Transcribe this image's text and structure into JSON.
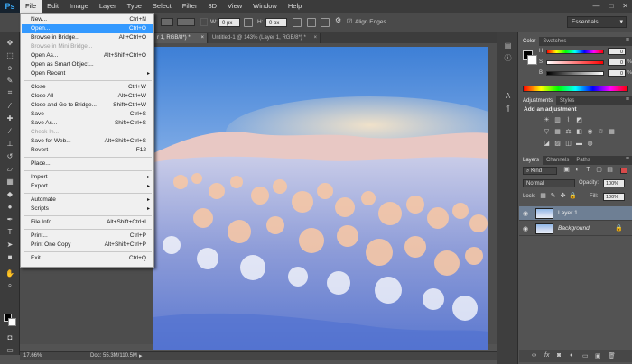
{
  "app": {
    "logo": "Ps"
  },
  "menubar": {
    "items": [
      "File",
      "Edit",
      "Image",
      "Layer",
      "Type",
      "Select",
      "Filter",
      "3D",
      "View",
      "Window",
      "Help"
    ],
    "active_index": 0
  },
  "window_controls": {
    "minimize": "—",
    "maximize": "□",
    "close": "✕"
  },
  "options_bar": {
    "w_label": "W:",
    "w_value": "0 px",
    "h_label": "H:",
    "h_value": "0 px",
    "align_edges": "Align Edges",
    "workspace": "Essentials"
  },
  "doc_tabs": [
    {
      "title": "r 1, RGB/8*) *",
      "close": "×"
    },
    {
      "title": "Untitled-1 @ 143% (Layer 1, RGB/8*) *",
      "close": "×"
    }
  ],
  "file_menu": {
    "items": [
      {
        "label": "New...",
        "shortcut": "Ctrl+N"
      },
      {
        "label": "Open...",
        "shortcut": "Ctrl+O",
        "highlight": true
      },
      {
        "label": "Browse in Bridge...",
        "shortcut": "Alt+Ctrl+O"
      },
      {
        "label": "Browse in Mini Bridge...",
        "shortcut": "",
        "disabled": true
      },
      {
        "label": "Open As...",
        "shortcut": "Alt+Shift+Ctrl+O"
      },
      {
        "label": "Open as Smart Object...",
        "shortcut": ""
      },
      {
        "label": "Open Recent",
        "shortcut": "",
        "submenu": true
      },
      {
        "label": "Close",
        "shortcut": "Ctrl+W"
      },
      {
        "label": "Close All",
        "shortcut": "Alt+Ctrl+W"
      },
      {
        "label": "Close and Go to Bridge...",
        "shortcut": "Shift+Ctrl+W"
      },
      {
        "label": "Save",
        "shortcut": "Ctrl+S"
      },
      {
        "label": "Save As...",
        "shortcut": "Shift+Ctrl+S"
      },
      {
        "label": "Check In...",
        "shortcut": "",
        "disabled": true
      },
      {
        "label": "Save for Web...",
        "shortcut": "Alt+Shift+Ctrl+S"
      },
      {
        "label": "Revert",
        "shortcut": "F12"
      },
      {
        "label": "Place...",
        "shortcut": ""
      },
      {
        "label": "Import",
        "shortcut": "",
        "submenu": true
      },
      {
        "label": "Export",
        "shortcut": "",
        "submenu": true
      },
      {
        "label": "Automate",
        "shortcut": "",
        "submenu": true
      },
      {
        "label": "Scripts",
        "shortcut": "",
        "submenu": true
      },
      {
        "label": "File Info...",
        "shortcut": "Alt+Shift+Ctrl+I"
      },
      {
        "label": "Print...",
        "shortcut": "Ctrl+P"
      },
      {
        "label": "Print One Copy",
        "shortcut": "Alt+Shift+Ctrl+P"
      },
      {
        "label": "Exit",
        "shortcut": "Ctrl+Q"
      }
    ],
    "submenu_arrow": "▸"
  },
  "color_panel": {
    "tabs": [
      "Color",
      "Swatches"
    ],
    "channels": [
      {
        "label": "H",
        "value": "0"
      },
      {
        "label": "S",
        "value": "0"
      },
      {
        "label": "B",
        "value": "0"
      }
    ],
    "percent": "%"
  },
  "adjustments_panel": {
    "tabs": [
      "Adjustments",
      "Styles"
    ],
    "title": "Add an adjustment"
  },
  "layers_panel": {
    "tabs": [
      "Layers",
      "Channels",
      "Paths"
    ],
    "kind": "Kind",
    "blend_mode": "Normal",
    "opacity_label": "Opacity:",
    "opacity_value": "100%",
    "lock_label": "Lock:",
    "fill_label": "Fill:",
    "fill_value": "100%",
    "layers": [
      {
        "name": "Layer 1",
        "selected": true
      },
      {
        "name": "Background",
        "italic": true,
        "locked": true
      }
    ]
  },
  "status_bar": {
    "zoom": "17.66%",
    "doc": "Doc: 55.3M/110.5M",
    "arrow": "▸"
  },
  "colors": {
    "menu_highlight": "#3399ff",
    "menubar_bg": "#3b3b3b",
    "panel_bg": "#535353"
  }
}
